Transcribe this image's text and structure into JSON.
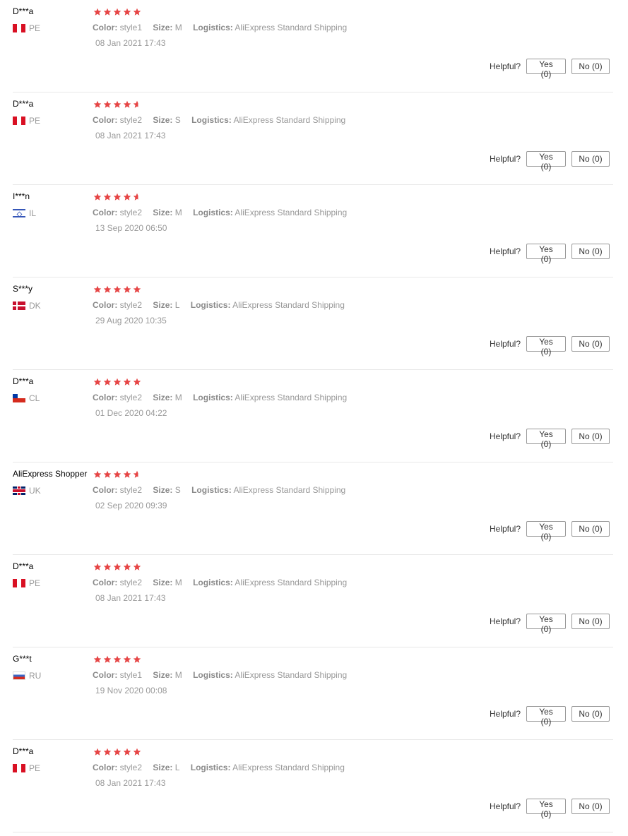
{
  "reviews": [
    {
      "user": "D***a",
      "country": "PE",
      "flag": "flag-pe",
      "rating": 5,
      "color_label": "Color:",
      "color": "style1",
      "size_label": "Size:",
      "size": "M",
      "logistics_label": "Logistics:",
      "logistics": "AliExpress Standard Shipping",
      "date": "08 Jan 2021 17:43",
      "helpful_label": "Helpful?",
      "yes": "Yes (0)",
      "no": "No (0)"
    },
    {
      "user": "D***a",
      "country": "PE",
      "flag": "flag-pe",
      "rating": 4.5,
      "color_label": "Color:",
      "color": "style2",
      "size_label": "Size:",
      "size": "S",
      "logistics_label": "Logistics:",
      "logistics": "AliExpress Standard Shipping",
      "date": "08 Jan 2021 17:43",
      "helpful_label": "Helpful?",
      "yes": "Yes (0)",
      "no": "No (0)"
    },
    {
      "user": "I***n",
      "country": "IL",
      "flag": "flag-il",
      "rating": 4.5,
      "color_label": "Color:",
      "color": "style2",
      "size_label": "Size:",
      "size": "M",
      "logistics_label": "Logistics:",
      "logistics": "AliExpress Standard Shipping",
      "date": "13 Sep 2020 06:50",
      "helpful_label": "Helpful?",
      "yes": "Yes (0)",
      "no": "No (0)"
    },
    {
      "user": "S***y",
      "country": "DK",
      "flag": "flag-dk",
      "rating": 5,
      "color_label": "Color:",
      "color": "style2",
      "size_label": "Size:",
      "size": "L",
      "logistics_label": "Logistics:",
      "logistics": "AliExpress Standard Shipping",
      "date": "29 Aug 2020 10:35",
      "helpful_label": "Helpful?",
      "yes": "Yes (0)",
      "no": "No (0)"
    },
    {
      "user": "D***a",
      "country": "CL",
      "flag": "flag-cl",
      "rating": 5,
      "color_label": "Color:",
      "color": "style2",
      "size_label": "Size:",
      "size": "M",
      "logistics_label": "Logistics:",
      "logistics": "AliExpress Standard Shipping",
      "date": "01 Dec 2020 04:22",
      "helpful_label": "Helpful?",
      "yes": "Yes (0)",
      "no": "No (0)"
    },
    {
      "user": "AliExpress Shopper",
      "country": "UK",
      "flag": "flag-uk",
      "rating": 4.5,
      "color_label": "Color:",
      "color": "style2",
      "size_label": "Size:",
      "size": "S",
      "logistics_label": "Logistics:",
      "logistics": "AliExpress Standard Shipping",
      "date": "02 Sep 2020 09:39",
      "helpful_label": "Helpful?",
      "yes": "Yes (0)",
      "no": "No (0)"
    },
    {
      "user": "D***a",
      "country": "PE",
      "flag": "flag-pe",
      "rating": 5,
      "color_label": "Color:",
      "color": "style2",
      "size_label": "Size:",
      "size": "M",
      "logistics_label": "Logistics:",
      "logistics": "AliExpress Standard Shipping",
      "date": "08 Jan 2021 17:43",
      "helpful_label": "Helpful?",
      "yes": "Yes (0)",
      "no": "No (0)"
    },
    {
      "user": "G***t",
      "country": "RU",
      "flag": "flag-ru",
      "rating": 5,
      "color_label": "Color:",
      "color": "style1",
      "size_label": "Size:",
      "size": "M",
      "logistics_label": "Logistics:",
      "logistics": "AliExpress Standard Shipping",
      "date": "19 Nov 2020 00:08",
      "helpful_label": "Helpful?",
      "yes": "Yes (0)",
      "no": "No (0)"
    },
    {
      "user": "D***a",
      "country": "PE",
      "flag": "flag-pe",
      "rating": 5,
      "color_label": "Color:",
      "color": "style2",
      "size_label": "Size:",
      "size": "L",
      "logistics_label": "Logistics:",
      "logistics": "AliExpress Standard Shipping",
      "date": "08 Jan 2021 17:43",
      "helpful_label": "Helpful?",
      "yes": "Yes (0)",
      "no": "No (0)"
    }
  ],
  "colors": {
    "star": "#e64545",
    "border": "#e8e8e8",
    "muted": "#999999"
  },
  "icons": {
    "star": "star-icon",
    "flag": "flag-icon"
  }
}
